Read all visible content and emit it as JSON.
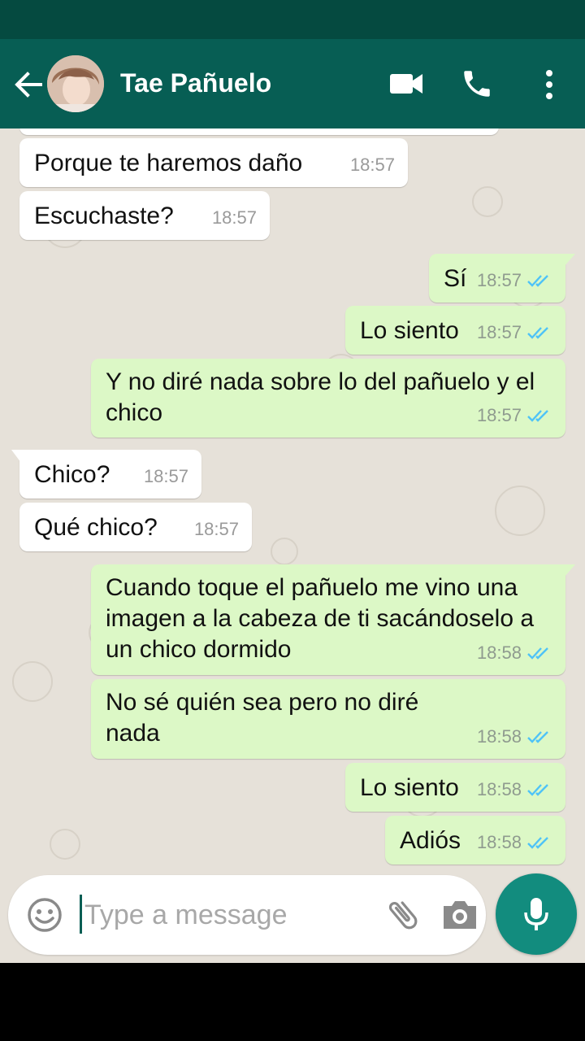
{
  "header": {
    "contact_name": "Tae Pañuelo",
    "icons": [
      "back-arrow-icon",
      "video-call-icon",
      "phone-icon",
      "more-vert-icon"
    ],
    "colors": {
      "appbar": "#075e54",
      "statusbar": "#054a40"
    }
  },
  "messages": [
    {
      "dir": "in",
      "text": "Porque te haremos daño",
      "time": "18:57"
    },
    {
      "dir": "in",
      "text": "Escuchaste?",
      "time": "18:57"
    },
    {
      "dir": "out",
      "text": "Sí",
      "time": "18:57",
      "status": "read"
    },
    {
      "dir": "out",
      "text": "Lo siento",
      "time": "18:57",
      "status": "read"
    },
    {
      "dir": "out",
      "text": "Y no diré nada sobre lo del pañuelo y el chico",
      "time": "18:57",
      "status": "read"
    },
    {
      "dir": "in",
      "text": "Chico?",
      "time": "18:57"
    },
    {
      "dir": "in",
      "text": "Qué chico?",
      "time": "18:57"
    },
    {
      "dir": "out",
      "text": "Cuando toque el pañuelo me vino una imagen a la cabeza de ti sacándoselo a un chico dormido",
      "time": "18:58",
      "status": "read"
    },
    {
      "dir": "out",
      "text": "No sé quién sea pero no diré nada",
      "time": "18:58",
      "status": "read"
    },
    {
      "dir": "out",
      "text": "Lo siento",
      "time": "18:58",
      "status": "read"
    },
    {
      "dir": "out",
      "text": "Adiós",
      "time": "18:58",
      "status": "read"
    }
  ],
  "composer": {
    "placeholder": "Type a message",
    "value": "",
    "icons": [
      "emoji-icon",
      "attach-icon",
      "camera-icon",
      "mic-icon"
    ]
  },
  "colors": {
    "incoming_bubble": "#ffffff",
    "outgoing_bubble": "#dcf8c6",
    "read_ticks": "#4fc3f7",
    "mic_button": "#128c7e"
  }
}
